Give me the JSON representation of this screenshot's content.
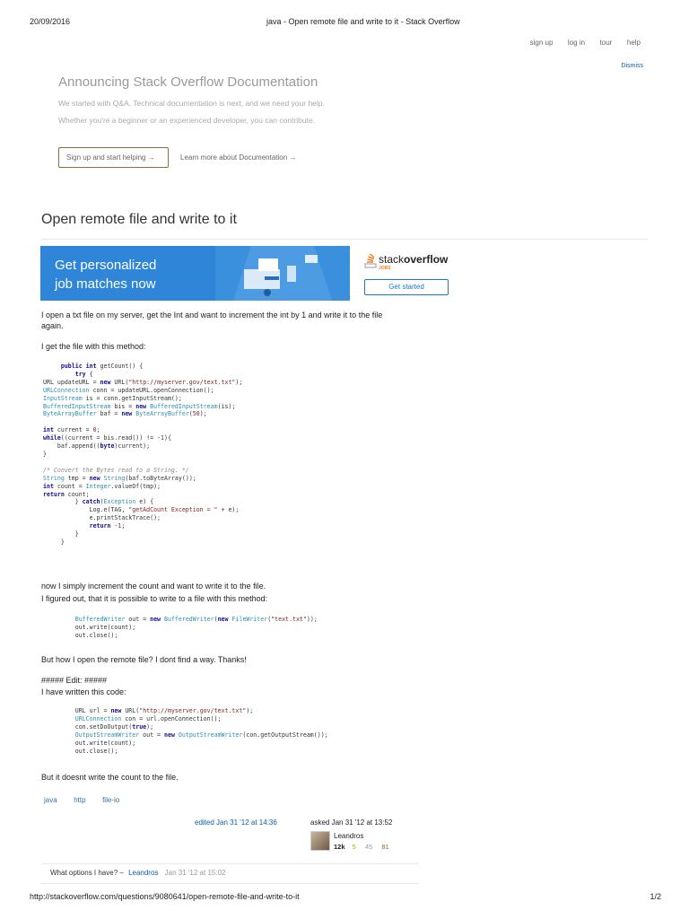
{
  "header": {
    "date": "20/09/2016",
    "title": "java - Open remote file and write to it - Stack Overflow",
    "nav": [
      "sign up",
      "log in",
      "tour",
      "help"
    ]
  },
  "banner": {
    "dismiss": "Dismiss",
    "title": "Announcing Stack Overflow Documentation",
    "line1": "We started with Q&A. Technical documentation is next, and we need your help.",
    "line2": "Whether you're a beginner or an experienced developer, you can contribute.",
    "signup_button": "Sign up and start helping →",
    "learn_link": "Learn more about Documentation →"
  },
  "question": {
    "title": "Open remote file and write to it",
    "p1": "I open a txt file on my server, get the Int and want to increment the int by 1 and write it to the file again.",
    "p2": "I get the file with this method:",
    "p3": "now I simply increment the count and want to write it to the file.",
    "p4": "I figured out, that it is possible to write to a file with this method:",
    "p5": "But how I open the remote file? I dont find a way. Thanks!",
    "p6": "##### Edit: #####",
    "p7": "I have written this code:",
    "p8": "But it doesnt write the count to the file.",
    "tags": [
      "java",
      "http",
      "file-io"
    ]
  },
  "ad": {
    "line1": "Get personalized",
    "line2": "job matches now",
    "brand_stack": "stack",
    "brand_overflow": "overflow",
    "brand_jobs": "JOBS",
    "button": "Get started"
  },
  "post_meta": {
    "edited": "edited Jan 31 '12 at 14:36",
    "asked": "asked Jan 31 '12 at 13:52",
    "user": "Leandros",
    "rep": "12k",
    "badges": [
      "5",
      "45",
      "81"
    ]
  },
  "comment": {
    "text": "What options I have? –",
    "user": "Leandros",
    "date": "Jan 31 '12 at 15:02"
  },
  "footer": {
    "url": "http://stackoverflow.com/questions/9080641/open-remote-file-and-write-to-it",
    "page": "1/2"
  }
}
